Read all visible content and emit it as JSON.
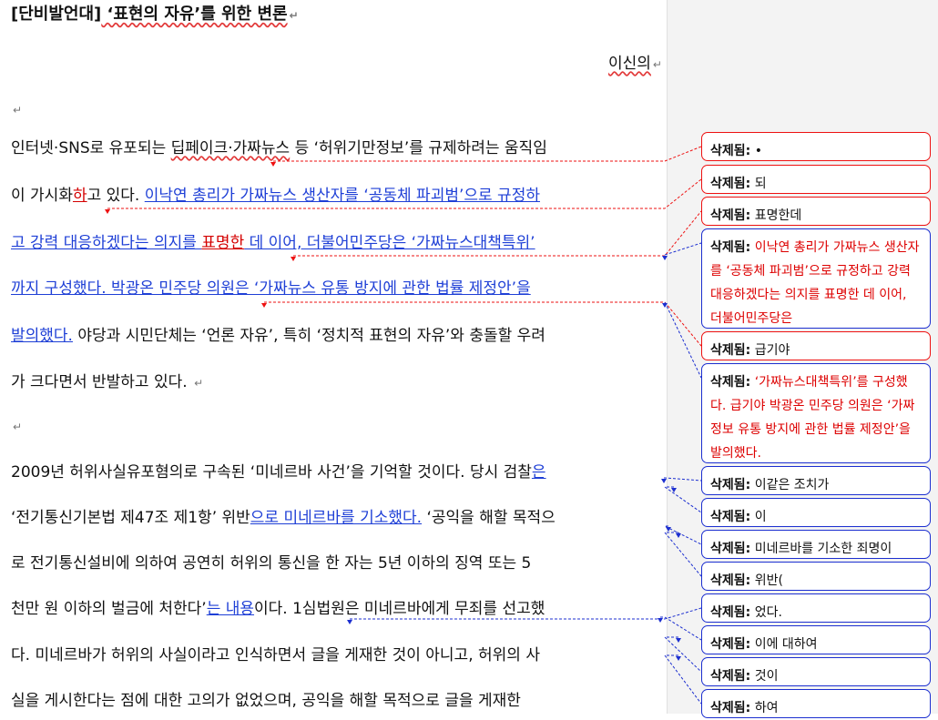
{
  "document": {
    "title_bracket": "[단비발언대]",
    "title_rest": " ‘표현의 자유’를 위한 변론",
    "author": "이신의",
    "para_mark": "↵",
    "lines": [
      {
        "segments": [
          {
            "t": "인터넷·SNS로 유포되는 ",
            "s": ""
          },
          {
            "t": "딥페이크·가짜뉴스",
            "s": "wavy"
          },
          {
            "t": " 등 ‘허위기만정보’를 규제하려는 움직임",
            "s": ""
          }
        ]
      },
      {
        "segments": [
          {
            "t": "이 가시화",
            "s": ""
          },
          {
            "t": "하",
            "s": "insred"
          },
          {
            "t": "고 있다. ",
            "s": ""
          },
          {
            "t": "이낙연 총리가 가짜뉴스 생산자를 ‘공동체 파괴범’으로 규정하",
            "s": "ins"
          }
        ]
      },
      {
        "segments": [
          {
            "t": "고 강력 대응하겠다는 의지를 ",
            "s": "ins"
          },
          {
            "t": "표명한",
            "s": "insred"
          },
          {
            "t": " 데 이어, 더불어민주당은 ‘가짜뉴스대책특위’",
            "s": "ins"
          }
        ]
      },
      {
        "segments": [
          {
            "t": "까지 구성했다. 박광온 민주당 의원은 ‘가짜뉴스 유통 방지에 관한 법률 제정안’을",
            "s": "ins"
          }
        ]
      },
      {
        "segments": [
          {
            "t": "발의했다.",
            "s": "ins"
          },
          {
            "t": " 야당과 시민단체는 ‘언론 자유’, 특히 ‘정치적 표현의 자유’와 충돌할 우려",
            "s": ""
          }
        ]
      },
      {
        "segments": [
          {
            "t": "가 크다면서 반발하고 있다. ",
            "s": ""
          }
        ]
      },
      {
        "segments": [
          {
            "t": "2009년 허위사실유포혐의로 구속된 ‘미네르바 사건’을 기억할 것이다. 당시 검찰",
            "s": ""
          },
          {
            "t": "은",
            "s": "ins"
          }
        ]
      },
      {
        "segments": [
          {
            "t": "‘전기통신기본법 제47조 제1항’ 위반",
            "s": ""
          },
          {
            "t": "으로 미네르바를 기소했다.",
            "s": "ins"
          },
          {
            "t": " ‘공익을 해할 목적으",
            "s": ""
          }
        ]
      },
      {
        "segments": [
          {
            "t": "로 전기통신설비에 의하여 공연히 허위의 통신을 한 자는 5년 이하의 징역 또는 5",
            "s": ""
          }
        ]
      },
      {
        "segments": [
          {
            "t": "천만 원 이하의 벌금에 처한다’",
            "s": ""
          },
          {
            "t": "는 내용",
            "s": "ins"
          },
          {
            "t": "이다. 1심법원은 미네르바에게 무죄를 선고했",
            "s": ""
          }
        ]
      },
      {
        "segments": [
          {
            "t": "다. 미네르바가 허위의 사실이라고 인식하면서 글을 게재한 것이 아니고, 허위의 사",
            "s": ""
          }
        ]
      },
      {
        "segments": [
          {
            "t": "실을 게시한다는 점에 대한 고의가 없었으며, 공익을 해할 목적으로 글을 게재한",
            "s": ""
          }
        ]
      }
    ]
  },
  "comments": {
    "label": "삭제됨:",
    "items": [
      {
        "text": "•",
        "color": "red"
      },
      {
        "text": "되",
        "color": "red"
      },
      {
        "text": "표명한데",
        "color": "red"
      },
      {
        "text": "이낙연 총리가 가짜뉴스 생산자를 ‘공동체 파괴범’으로 규정하고 강력 대응하겠다는 의지를 표명한 데 이어, 더불어민주당은",
        "color": "blue",
        "redtext": true
      },
      {
        "text": "급기야",
        "color": "red"
      },
      {
        "text": "‘가짜뉴스대책특위’를 구성했다. 급기야 박광온 민주당 의원은 ‘가짜정보 유통 방지에 관한 법률 제정안’을 발의했다.",
        "color": "blue",
        "redtext": true
      },
      {
        "text": "이같은 조치가",
        "color": "blue"
      },
      {
        "text": "이",
        "color": "blue"
      },
      {
        "text": "미네르바를 기소한 죄명이",
        "color": "blue"
      },
      {
        "text": "위반(",
        "color": "blue"
      },
      {
        "text": "었다.",
        "color": "blue"
      },
      {
        "text": "이에 대하여",
        "color": "blue"
      },
      {
        "text": "것이",
        "color": "blue"
      },
      {
        "text": "하여",
        "color": "blue"
      }
    ]
  },
  "colors": {
    "insert_blue": "#1e3fd6",
    "delete_red": "#d40000",
    "margin_bg": "#f3f3f3"
  }
}
